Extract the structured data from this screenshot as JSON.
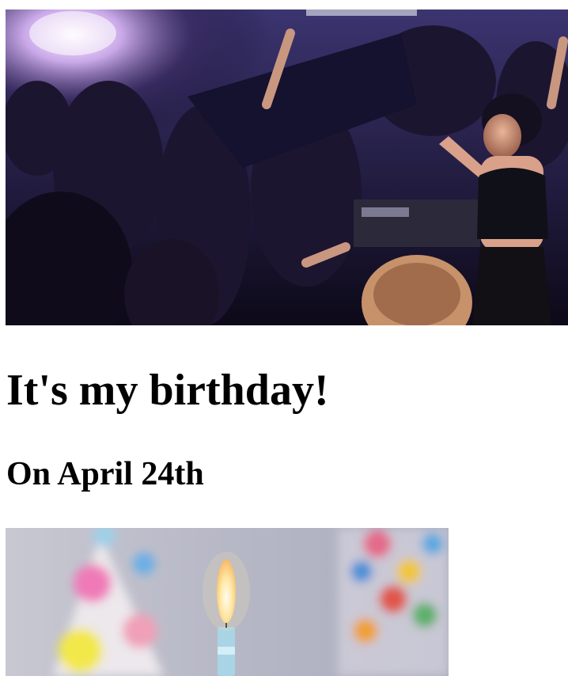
{
  "page": {
    "heading": "It's my birthday!",
    "subheading": "On April 24th"
  },
  "images": {
    "hero": {
      "description_icon": "party-crowd-photo",
      "alt": ""
    },
    "cake": {
      "description_icon": "birthday-candle-photo",
      "alt": ""
    }
  },
  "colors": {
    "hero_shadow": "#120c28",
    "hero_light": "#f4e6ff",
    "cake_background": "#bfc0cc",
    "candle_flame": "#ffe9a8",
    "candle_body": "#a9d4e6"
  }
}
